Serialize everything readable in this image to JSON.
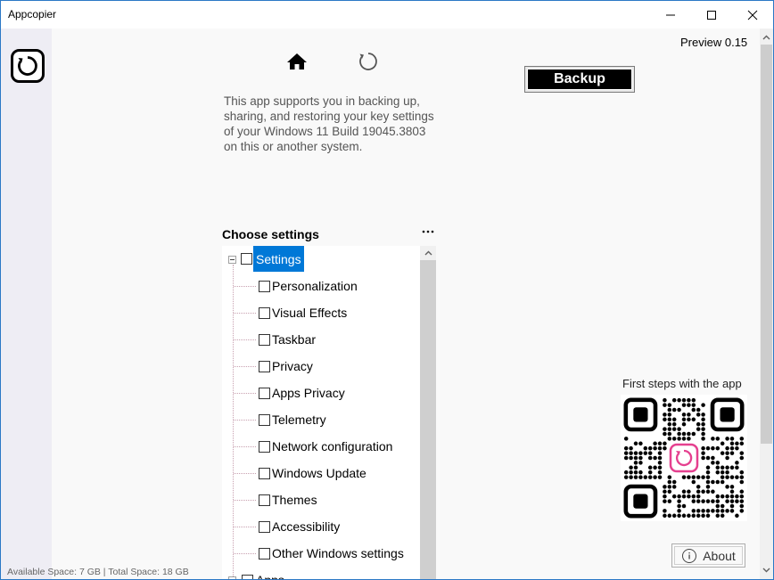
{
  "window": {
    "title": "Appcopier",
    "controls": [
      "minimize-icon",
      "maximize-icon",
      "close-icon"
    ]
  },
  "sidebar": {
    "logo_icon": "refresh-circle-icon"
  },
  "nav": {
    "home_icon": "home-icon",
    "restore_icon": "refresh-icon"
  },
  "header": {
    "version": "Preview 0.15",
    "backup_label": "Backup"
  },
  "description": "This app supports you in backing up, sharing, and restoring your key settings of your Windows 11 Build 19045.3803 on this or another system.",
  "settings": {
    "title": "Choose settings",
    "more_icon": "more-horizontal-icon",
    "root_label": "Settings",
    "items": [
      {
        "label": "Personalization"
      },
      {
        "label": "Visual Effects"
      },
      {
        "label": "Taskbar"
      },
      {
        "label": "Privacy"
      },
      {
        "label": "Apps Privacy"
      },
      {
        "label": "Telemetry"
      },
      {
        "label": "Network configuration"
      },
      {
        "label": "Windows Update"
      },
      {
        "label": "Themes"
      },
      {
        "label": "Accessibility"
      },
      {
        "label": "Other Windows settings"
      }
    ],
    "second_root_label": "Apps"
  },
  "right_panel": {
    "first_steps": "First steps with the app",
    "qr_icon": "qr-code-icon",
    "about_label": "About",
    "about_icon": "info-icon"
  },
  "footer": {
    "space_info": "Available Space: 7 GB | Total Space: 18 GB"
  },
  "colors": {
    "accent": "#0078d7",
    "sidebar_bg": "#eeedf4",
    "qr_logo": "#e5408f"
  }
}
